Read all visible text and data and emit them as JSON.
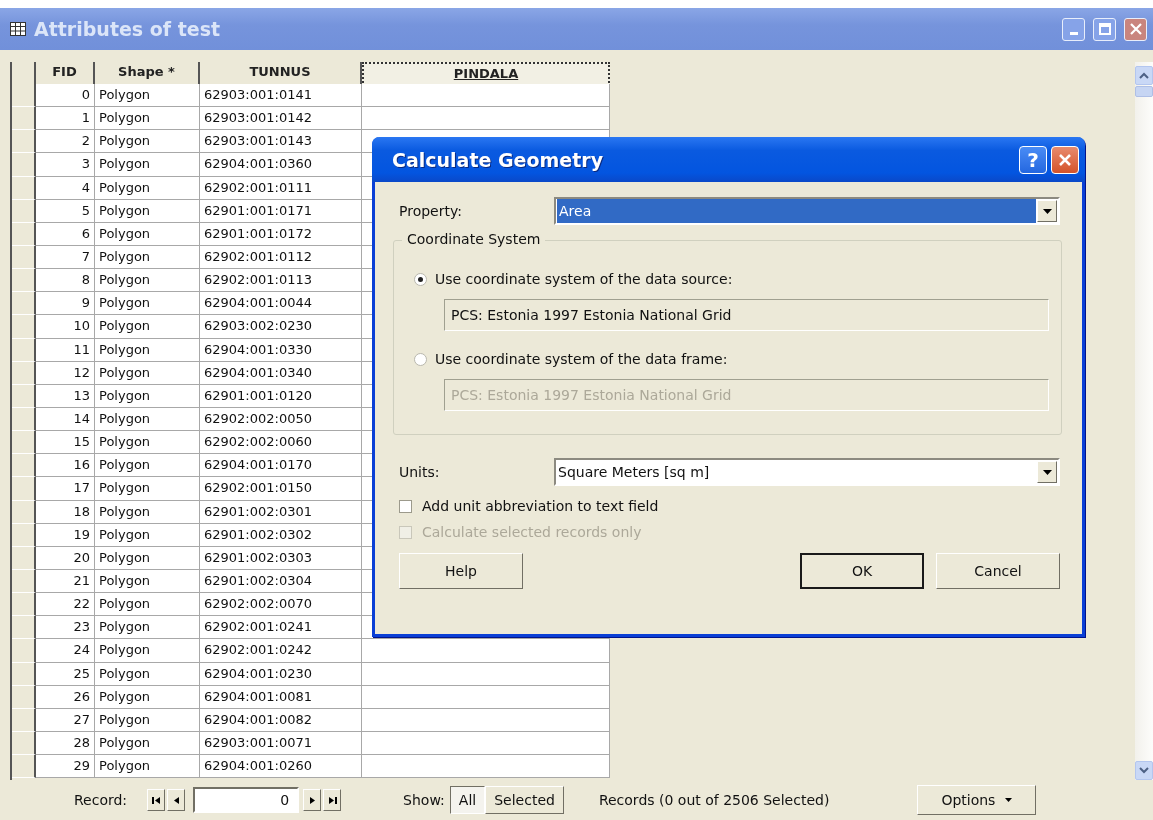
{
  "window": {
    "title": "Attributes of test"
  },
  "table": {
    "columns": [
      {
        "label": "FID",
        "selected": false
      },
      {
        "label": "Shape *",
        "selected": false
      },
      {
        "label": "TUNNUS",
        "selected": false
      },
      {
        "label": "PINDALA",
        "selected": true
      }
    ],
    "rows": [
      {
        "fid": "0",
        "shape": "Polygon",
        "tunnus": "62903:001:0141"
      },
      {
        "fid": "1",
        "shape": "Polygon",
        "tunnus": "62903:001:0142"
      },
      {
        "fid": "2",
        "shape": "Polygon",
        "tunnus": "62903:001:0143"
      },
      {
        "fid": "3",
        "shape": "Polygon",
        "tunnus": "62904:001:0360"
      },
      {
        "fid": "4",
        "shape": "Polygon",
        "tunnus": "62902:001:0111"
      },
      {
        "fid": "5",
        "shape": "Polygon",
        "tunnus": "62901:001:0171"
      },
      {
        "fid": "6",
        "shape": "Polygon",
        "tunnus": "62901:001:0172"
      },
      {
        "fid": "7",
        "shape": "Polygon",
        "tunnus": "62902:001:0112"
      },
      {
        "fid": "8",
        "shape": "Polygon",
        "tunnus": "62902:001:0113"
      },
      {
        "fid": "9",
        "shape": "Polygon",
        "tunnus": "62904:001:0044"
      },
      {
        "fid": "10",
        "shape": "Polygon",
        "tunnus": "62903:002:0230"
      },
      {
        "fid": "11",
        "shape": "Polygon",
        "tunnus": "62904:001:0330"
      },
      {
        "fid": "12",
        "shape": "Polygon",
        "tunnus": "62904:001:0340"
      },
      {
        "fid": "13",
        "shape": "Polygon",
        "tunnus": "62901:001:0120"
      },
      {
        "fid": "14",
        "shape": "Polygon",
        "tunnus": "62902:002:0050"
      },
      {
        "fid": "15",
        "shape": "Polygon",
        "tunnus": "62902:002:0060"
      },
      {
        "fid": "16",
        "shape": "Polygon",
        "tunnus": "62904:001:0170"
      },
      {
        "fid": "17",
        "shape": "Polygon",
        "tunnus": "62902:001:0150"
      },
      {
        "fid": "18",
        "shape": "Polygon",
        "tunnus": "62901:002:0301"
      },
      {
        "fid": "19",
        "shape": "Polygon",
        "tunnus": "62901:002:0302"
      },
      {
        "fid": "20",
        "shape": "Polygon",
        "tunnus": "62901:002:0303"
      },
      {
        "fid": "21",
        "shape": "Polygon",
        "tunnus": "62901:002:0304"
      },
      {
        "fid": "22",
        "shape": "Polygon",
        "tunnus": "62902:002:0070"
      },
      {
        "fid": "23",
        "shape": "Polygon",
        "tunnus": "62902:001:0241"
      },
      {
        "fid": "24",
        "shape": "Polygon",
        "tunnus": "62902:001:0242"
      },
      {
        "fid": "25",
        "shape": "Polygon",
        "tunnus": "62904:001:0230"
      },
      {
        "fid": "26",
        "shape": "Polygon",
        "tunnus": "62904:001:0081"
      },
      {
        "fid": "27",
        "shape": "Polygon",
        "tunnus": "62904:001:0082"
      },
      {
        "fid": "28",
        "shape": "Polygon",
        "tunnus": "62903:001:0071"
      },
      {
        "fid": "29",
        "shape": "Polygon",
        "tunnus": "62904:001:0260"
      }
    ]
  },
  "dialog": {
    "title": "Calculate Geometry",
    "help_glyph": "?",
    "property": {
      "label": "Property:",
      "value": "Area"
    },
    "coordinate_system": {
      "title": "Coordinate System",
      "options": [
        {
          "label": "Use coordinate system of the data source:",
          "selected": true,
          "value": "PCS: Estonia 1997 Estonia National Grid"
        },
        {
          "label": "Use coordinate system of the data frame:",
          "selected": false,
          "value": "PCS: Estonia 1997 Estonia National Grid"
        }
      ]
    },
    "units": {
      "label": "Units:",
      "value": "Square Meters [sq m]"
    },
    "checkboxes": [
      {
        "label": "Add unit abbreviation to text field",
        "checked": false,
        "disabled": false
      },
      {
        "label": "Calculate selected records only",
        "checked": false,
        "disabled": true
      }
    ],
    "buttons": [
      {
        "label": "Help",
        "default": false
      },
      {
        "label": "OK",
        "default": true
      },
      {
        "label": "Cancel",
        "default": false
      }
    ]
  },
  "status_bar": {
    "record_label": "Record:",
    "record_value": "0",
    "show_label": "Show:",
    "show_options": [
      {
        "label": "All",
        "selected": true
      },
      {
        "label": "Selected",
        "selected": false
      }
    ],
    "summary": "Records (0 out of 2506 Selected)",
    "options": "Options"
  }
}
